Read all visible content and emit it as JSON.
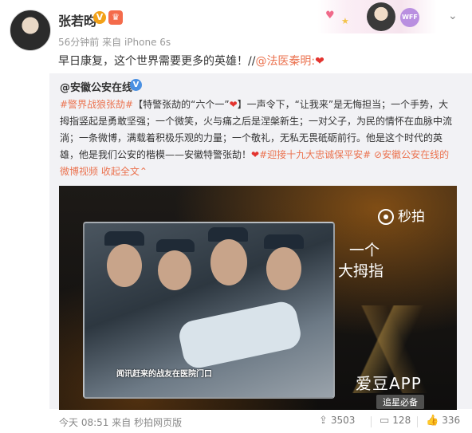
{
  "post": {
    "author": "张若昀",
    "verified_badge": "V",
    "vip_badge": "♛",
    "time": "56分钟前",
    "source_prefix": "来自",
    "source": "iPhone 6s",
    "text_main": "早日康复，这个世界需要更多的英雄！//",
    "text_mention": "@法医秦明:",
    "text_heart": "❤"
  },
  "retweet": {
    "author": "@安徽公安在线",
    "verified_badge": "V",
    "hashtag1": "#警界战狼张劼#",
    "bracket_open": "【特警张劼的“六个一”",
    "bracket_heart": "❤",
    "bracket_close": "】",
    "body": "一声令下，“让我来”是无悔担当；一个手势，大拇指竖起是勇敢坚强；一个微笑，火与痛之后是涅槃新生；一对父子，为民的情怀在血脉中流淌；一条微博，满载着积极乐观的力量；一个敬礼，无私无畏砥砺前行。他是这个时代的英雄，他是我们公安的楷模——安徽特警张劼！",
    "body_heart": "❤",
    "hashtag2": "#迎接十九大忠诚保平安#",
    "video_link": "⊘安徽公安在线的微博视频",
    "collapse": "收起全文",
    "collapse_arrow": "⌃"
  },
  "video": {
    "watermark_icon": "miaopai-icon",
    "watermark": "秒拍",
    "overlay_line1": "一个",
    "overlay_line2": "大拇指",
    "frame_caption": "闻讯赶来的战友在医院门口",
    "app_logo": "爱豆APP",
    "app_sub": "追星必备"
  },
  "footer": {
    "time": "今天 08:51",
    "source_prefix": "来自",
    "source": "秒拍网页版",
    "share_count": "3503",
    "comment_count": "128",
    "like_count": "336"
  },
  "colors": {
    "link": "#eb7350",
    "heart": "#e3342f",
    "retweet_bg": "#f2f2f5",
    "meta": "#999999"
  }
}
